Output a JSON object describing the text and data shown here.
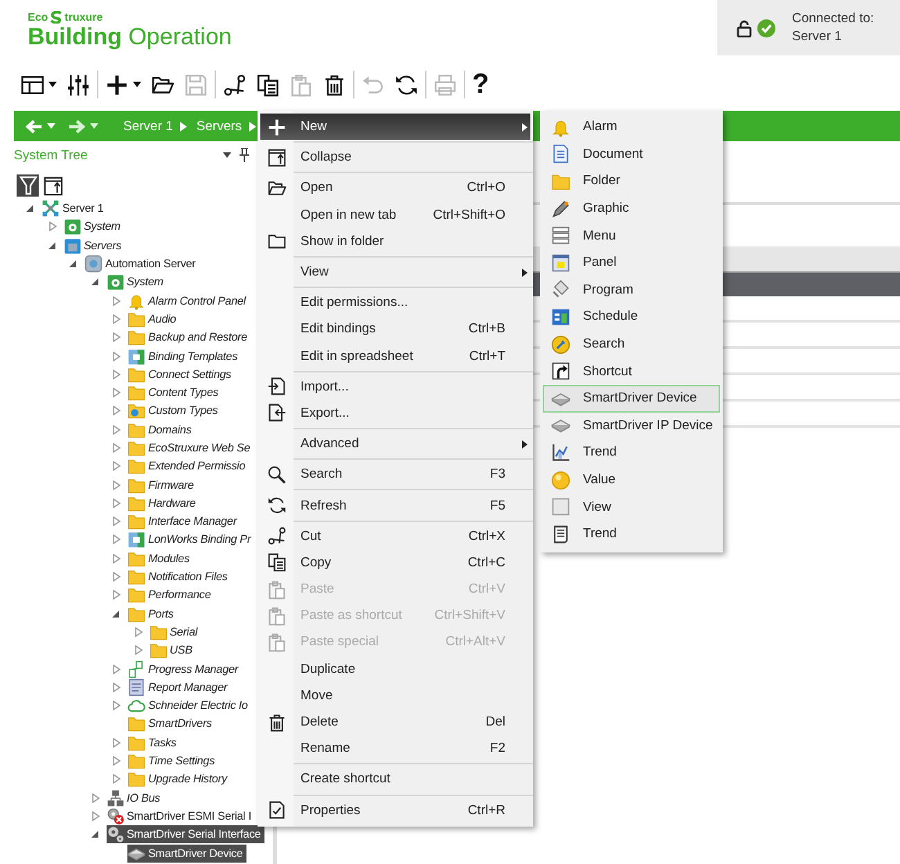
{
  "header": {
    "brand_prefix": "Eco",
    "brand_suffix": "truxure",
    "product": "**Building** Operation",
    "connection_label": "Connected to:",
    "connection_server": "Server 1"
  },
  "toolbar": [
    [
      {
        "kind": "layout",
        "dropdown": true,
        "disabled": false
      },
      {
        "kind": "sliders",
        "dropdown": false,
        "disabled": false
      }
    ],
    [
      {
        "kind": "plus",
        "dropdown": true,
        "disabled": false
      },
      {
        "kind": "open",
        "dropdown": false,
        "disabled": false
      },
      {
        "kind": "save",
        "dropdown": false,
        "disabled": true
      }
    ],
    [
      {
        "kind": "cut",
        "dropdown": false,
        "disabled": false
      },
      {
        "kind": "copy",
        "dropdown": false,
        "disabled": false
      },
      {
        "kind": "paste",
        "dropdown": false,
        "disabled": true
      },
      {
        "kind": "delete",
        "dropdown": false,
        "disabled": false
      }
    ],
    [
      {
        "kind": "undo",
        "dropdown": false,
        "disabled": true
      },
      {
        "kind": "refresh",
        "dropdown": false,
        "disabled": false
      }
    ],
    [
      {
        "kind": "print",
        "dropdown": false,
        "disabled": true
      }
    ],
    [
      {
        "kind": "help",
        "label": "?",
        "disabled": false
      }
    ]
  ],
  "nav": {
    "crumbs": [
      "Server 1",
      "Servers"
    ]
  },
  "tree_panel": {
    "title": "System Tree",
    "tree": [
      {
        "label": "Server 1",
        "kind": "network",
        "italic": false,
        "expanded": true,
        "selected": false,
        "children": [
          {
            "label": "System",
            "kind": "system",
            "italic": true,
            "expanded": false,
            "selected": false
          },
          {
            "label": "Servers",
            "kind": "servers",
            "italic": true,
            "expanded": true,
            "selected": false,
            "children": [
              {
                "label": "Automation Server",
                "kind": "automation",
                "italic": false,
                "expanded": true,
                "selected": false,
                "children": [
                  {
                    "label": "System",
                    "kind": "system",
                    "italic": true,
                    "expanded": true,
                    "selected": false,
                    "children": [
                      {
                        "label": "Alarm Control Panel",
                        "kind": "bell",
                        "italic": true,
                        "expanded": false,
                        "selected": false
                      },
                      {
                        "label": "Audio",
                        "kind": "folder",
                        "italic": true,
                        "expanded": false,
                        "selected": false
                      },
                      {
                        "label": "Backup and Restore",
                        "kind": "folder",
                        "italic": true,
                        "expanded": false,
                        "selected": false
                      },
                      {
                        "label": "Binding Templates",
                        "kind": "binding",
                        "italic": true,
                        "expanded": false,
                        "selected": false
                      },
                      {
                        "label": "Connect Settings",
                        "kind": "folder",
                        "italic": true,
                        "expanded": false,
                        "selected": false
                      },
                      {
                        "label": "Content Types",
                        "kind": "folder",
                        "italic": true,
                        "expanded": false,
                        "selected": false
                      },
                      {
                        "label": "Custom Types",
                        "kind": "custom",
                        "italic": true,
                        "expanded": false,
                        "selected": false
                      },
                      {
                        "label": "Domains",
                        "kind": "folder",
                        "italic": true,
                        "expanded": false,
                        "selected": false
                      },
                      {
                        "label": "EcoStruxure Web Se",
                        "kind": "folder",
                        "italic": true,
                        "expanded": false,
                        "selected": false
                      },
                      {
                        "label": "Extended Permissio",
                        "kind": "folder",
                        "italic": true,
                        "expanded": false,
                        "selected": false
                      },
                      {
                        "label": "Firmware",
                        "kind": "folder",
                        "italic": true,
                        "expanded": false,
                        "selected": false
                      },
                      {
                        "label": "Hardware",
                        "kind": "folder",
                        "italic": true,
                        "expanded": false,
                        "selected": false
                      },
                      {
                        "label": "Interface Manager",
                        "kind": "folder",
                        "italic": true,
                        "expanded": false,
                        "selected": false
                      },
                      {
                        "label": "LonWorks Binding Pr",
                        "kind": "binding",
                        "italic": true,
                        "expanded": false,
                        "selected": false
                      },
                      {
                        "label": "Modules",
                        "kind": "folder",
                        "italic": true,
                        "expanded": false,
                        "selected": false
                      },
                      {
                        "label": "Notification Files",
                        "kind": "folder",
                        "italic": true,
                        "expanded": false,
                        "selected": false
                      },
                      {
                        "label": "Performance",
                        "kind": "folder",
                        "italic": true,
                        "expanded": false,
                        "selected": false
                      },
                      {
                        "label": "Ports",
                        "kind": "folder",
                        "italic": true,
                        "expanded": true,
                        "selected": false,
                        "children": [
                          {
                            "label": "Serial",
                            "kind": "folder",
                            "italic": true,
                            "expanded": false,
                            "selected": false
                          },
                          {
                            "label": "USB",
                            "kind": "folder",
                            "italic": true,
                            "expanded": false,
                            "selected": false
                          }
                        ]
                      },
                      {
                        "label": "Progress Manager",
                        "kind": "progress",
                        "italic": true,
                        "expanded": false,
                        "selected": false
                      },
                      {
                        "label": "Report Manager",
                        "kind": "report",
                        "italic": true,
                        "expanded": false,
                        "selected": false
                      },
                      {
                        "label": "Schneider Electric Io",
                        "kind": "cloud",
                        "italic": true,
                        "expanded": false,
                        "selected": false
                      },
                      {
                        "label": "SmartDrivers",
                        "kind": "folder",
                        "italic": true,
                        "selected": false
                      },
                      {
                        "label": "Tasks",
                        "kind": "folder",
                        "italic": true,
                        "expanded": false,
                        "selected": false
                      },
                      {
                        "label": "Time Settings",
                        "kind": "folder",
                        "italic": true,
                        "expanded": false,
                        "selected": false
                      },
                      {
                        "label": "Upgrade History",
                        "kind": "folder",
                        "italic": true,
                        "expanded": false,
                        "selected": false
                      }
                    ]
                  },
                  {
                    "label": "IO Bus",
                    "kind": "iobus",
                    "italic": true,
                    "expanded": false,
                    "selected": false
                  },
                  {
                    "label": "SmartDriver ESMI Serial I",
                    "kind": "esmi",
                    "italic": false,
                    "expanded": false,
                    "selected": false
                  },
                  {
                    "label": "SmartDriver Serial Interface",
                    "kind": "serial",
                    "italic": false,
                    "expanded": true,
                    "selected": true,
                    "children": [
                      {
                        "label": "SmartDriver Device",
                        "kind": "device",
                        "italic": false,
                        "selected": true
                      }
                    ]
                  }
                ]
              }
            ]
          }
        ]
      }
    ]
  },
  "context_menu": {
    "groups": [
      [
        {
          "label": "New",
          "kind": "submenu",
          "selected": true,
          "disabled": false
        }
      ],
      [
        {
          "label": "Collapse",
          "kind": "command",
          "selected": false,
          "disabled": false
        }
      ],
      [
        {
          "label": "Open",
          "shortcut": "Ctrl+O",
          "kind": "command",
          "selected": false,
          "disabled": false
        },
        {
          "label": "Open in new tab",
          "shortcut": "Ctrl+Shift+O",
          "kind": "command",
          "selected": false,
          "disabled": false
        },
        {
          "label": "Show in folder",
          "kind": "command",
          "selected": false,
          "disabled": false
        }
      ],
      [
        {
          "label": "View",
          "kind": "submenu",
          "selected": false,
          "disabled": false
        }
      ],
      [
        {
          "label": "Edit permissions...",
          "kind": "command",
          "selected": false,
          "disabled": false
        },
        {
          "label": "Edit bindings",
          "shortcut": "Ctrl+B",
          "kind": "command",
          "selected": false,
          "disabled": false
        },
        {
          "label": "Edit in spreadsheet",
          "shortcut": "Ctrl+T",
          "kind": "command",
          "selected": false,
          "disabled": false
        }
      ],
      [
        {
          "label": "Import...",
          "kind": "command",
          "selected": false,
          "disabled": false
        },
        {
          "label": "Export...",
          "kind": "command",
          "selected": false,
          "disabled": false
        }
      ],
      [
        {
          "label": "Advanced",
          "kind": "submenu",
          "selected": false,
          "disabled": false
        }
      ],
      [
        {
          "label": "Search",
          "shortcut": "F3",
          "kind": "command",
          "selected": false,
          "disabled": false
        }
      ],
      [
        {
          "label": "Refresh",
          "shortcut": "F5",
          "kind": "command",
          "selected": false,
          "disabled": false
        }
      ],
      [
        {
          "label": "Cut",
          "shortcut": "Ctrl+X",
          "kind": "command",
          "selected": false,
          "disabled": false
        },
        {
          "label": "Copy",
          "shortcut": "Ctrl+C",
          "kind": "command",
          "selected": false,
          "disabled": false
        },
        {
          "label": "Paste",
          "shortcut": "Ctrl+V",
          "kind": "command",
          "selected": false,
          "disabled": true
        },
        {
          "label": "Paste as shortcut",
          "shortcut": "Ctrl+Shift+V",
          "kind": "command",
          "selected": false,
          "disabled": true
        },
        {
          "label": "Paste special",
          "shortcut": "Ctrl+Alt+V",
          "kind": "command",
          "selected": false,
          "disabled": true
        },
        {
          "label": "Duplicate",
          "kind": "command",
          "selected": false,
          "disabled": false
        },
        {
          "label": "Move",
          "kind": "command",
          "selected": false,
          "disabled": false
        },
        {
          "label": "Delete",
          "shortcut": "Del",
          "kind": "command",
          "selected": false,
          "disabled": false
        },
        {
          "label": "Rename",
          "shortcut": "F2",
          "kind": "command",
          "selected": false,
          "disabled": false
        }
      ],
      [
        {
          "label": "Create shortcut",
          "kind": "command",
          "selected": false,
          "disabled": false
        }
      ],
      [
        {
          "label": "Properties",
          "shortcut": "Ctrl+R",
          "kind": "command",
          "selected": false,
          "disabled": false
        }
      ]
    ]
  },
  "new_submenu": {
    "items": [
      {
        "label": "Alarm",
        "selected": false
      },
      {
        "label": "Document",
        "selected": false
      },
      {
        "label": "Folder",
        "selected": false
      },
      {
        "label": "Graphic",
        "selected": false
      },
      {
        "label": "Menu",
        "selected": false
      },
      {
        "label": "Panel",
        "selected": false
      },
      {
        "label": "Program",
        "selected": false
      },
      {
        "label": "Schedule",
        "selected": false
      },
      {
        "label": "Search",
        "selected": false
      },
      {
        "label": "Shortcut",
        "selected": false
      },
      {
        "label": "SmartDriver Device",
        "selected": true
      },
      {
        "label": "SmartDriver IP Device",
        "selected": false
      },
      {
        "label": "Trend",
        "selected": false
      },
      {
        "label": "Value",
        "selected": false
      },
      {
        "label": "View",
        "selected": false
      },
      {
        "label": "Trend",
        "selected": false
      }
    ]
  }
}
